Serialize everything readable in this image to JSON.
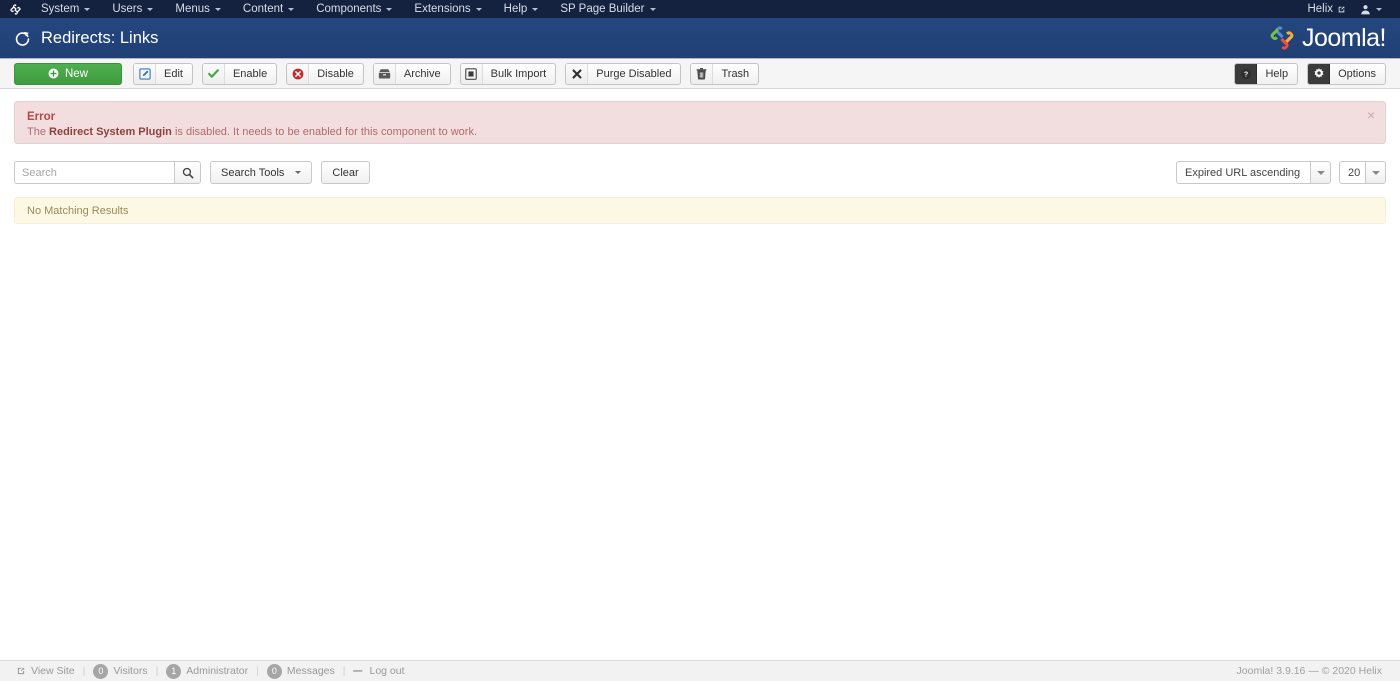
{
  "topbar": {
    "brand_icon": "joomla-mark-icon",
    "menu": [
      {
        "label": "System",
        "has_caret": true
      },
      {
        "label": "Users",
        "has_caret": true
      },
      {
        "label": "Menus",
        "has_caret": true
      },
      {
        "label": "Content",
        "has_caret": true
      },
      {
        "label": "Components",
        "has_caret": true
      },
      {
        "label": "Extensions",
        "has_caret": true
      },
      {
        "label": "Help",
        "has_caret": true
      },
      {
        "label": "SP Page Builder",
        "has_caret": true
      }
    ],
    "site_link": "Helix",
    "site_link_icon": "external-link-icon",
    "user_icon": "user-icon"
  },
  "subheader": {
    "title": "Redirects: Links",
    "title_icon": "redo-circle-arrow-icon",
    "logo_text": "Joomla!",
    "logo_icon": "joomla-logo-icon"
  },
  "toolbar": {
    "new_label": "New",
    "new_icon": "plus-circle-icon",
    "buttons": [
      {
        "label": "Edit",
        "icon": "pencil-square-icon"
      },
      {
        "label": "Enable",
        "icon": "check-icon"
      },
      {
        "label": "Disable",
        "icon": "times-circle-icon"
      },
      {
        "label": "Archive",
        "icon": "archive-box-icon"
      },
      {
        "label": "Bulk Import",
        "icon": "filled-square-icon"
      },
      {
        "label": "Purge Disabled",
        "icon": "times-icon"
      },
      {
        "label": "Trash",
        "icon": "trash-can-icon"
      }
    ],
    "help_label": "Help",
    "help_icon": "question-circle-icon",
    "options_label": "Options",
    "options_icon": "gear-icon"
  },
  "alert": {
    "title": "Error",
    "text_before": "The ",
    "text_bold": "Redirect System Plugin",
    "text_after": " is disabled. It needs to be enabled for this component to work.",
    "close_icon": "close-icon",
    "close_label": "×"
  },
  "search": {
    "placeholder": "Search",
    "value": "",
    "search_icon": "search-icon",
    "search_tools_label": "Search Tools",
    "clear_label": "Clear",
    "sort_value": "Expired URL ascending",
    "limit_value": "20"
  },
  "results": {
    "empty_message": "No Matching Results"
  },
  "footer": {
    "view_site_label": "View Site",
    "view_site_icon": "external-link-icon",
    "visitors_count": "0",
    "visitors_label": "Visitors",
    "administrator_count": "1",
    "administrator_label": "Administrator",
    "messages_count": "0",
    "messages_label": "Messages",
    "logout_label": "Log out",
    "logout_icon": "minus-icon",
    "copyright": "Joomla! 3.9.16  —  © 2020 Helix"
  },
  "colors": {
    "topbar_bg": "#14213f",
    "subheader_bg": "#22447e",
    "new_button": "#3f9d3f",
    "error_bg": "#f2dede",
    "error_text": "#b94a48",
    "warning_bg": "#fcf8e3"
  }
}
